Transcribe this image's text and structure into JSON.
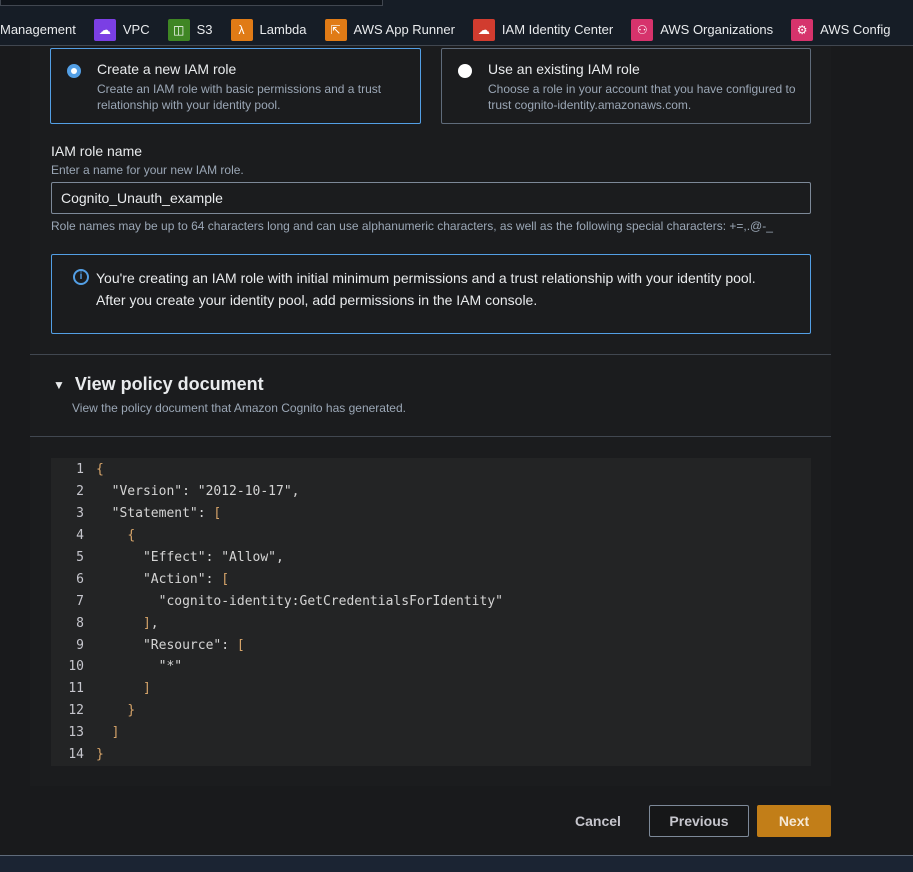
{
  "nav": {
    "items": [
      {
        "label": "Management",
        "icon": "none",
        "color": ""
      },
      {
        "label": "VPC",
        "icon": "vpc-icon",
        "color": "#7b3fe4"
      },
      {
        "label": "S3",
        "icon": "s3-bucket-icon",
        "color": "#3f8624"
      },
      {
        "label": "Lambda",
        "icon": "lambda-icon",
        "color": "#e07b16"
      },
      {
        "label": "AWS App Runner",
        "icon": "app-runner-icon",
        "color": "#e07b16"
      },
      {
        "label": "IAM Identity Center",
        "icon": "iam-identity-center-icon",
        "color": "#d13c2f"
      },
      {
        "label": "AWS Organizations",
        "icon": "organizations-icon",
        "color": "#d6336c"
      },
      {
        "label": "AWS Config",
        "icon": "config-icon",
        "color": "#d6336c"
      }
    ]
  },
  "role_options": {
    "create": {
      "title": "Create a new IAM role",
      "desc": "Create an IAM role with basic permissions and a trust relationship with your identity pool.",
      "selected": true
    },
    "existing": {
      "title": "Use an existing IAM role",
      "desc": "Choose a role in your account that you have configured to trust cognito-identity.amazonaws.com.",
      "selected": false
    }
  },
  "role_name": {
    "label": "IAM role name",
    "description": "Enter a name for your new IAM role.",
    "value": "Cognito_Unauth_example",
    "constraint": "Role names may be up to 64 characters long and can use alphanumeric characters, as well as the following special characters: +=,.@-_"
  },
  "alert": {
    "icon": "info-icon",
    "line1": "You're creating an IAM role with initial minimum permissions and a trust relationship with your identity pool.",
    "line2": "After you create your identity pool, add permissions in the IAM console."
  },
  "policy": {
    "title": "View policy document",
    "subtitle": "View the policy document that Amazon Cognito has generated.",
    "expanded": true,
    "lines": [
      "{",
      "  \"Version\": \"2012-10-17\",",
      "  \"Statement\": [",
      "    {",
      "      \"Effect\": \"Allow\",",
      "      \"Action\": [",
      "        \"cognito-identity:GetCredentialsForIdentity\"",
      "      ],",
      "      \"Resource\": [",
      "        \"*\"",
      "      ]",
      "    }",
      "  ]",
      "}"
    ]
  },
  "footer": {
    "cancel": "Cancel",
    "previous": "Previous",
    "next": "Next",
    "accent": "#c27e18"
  }
}
